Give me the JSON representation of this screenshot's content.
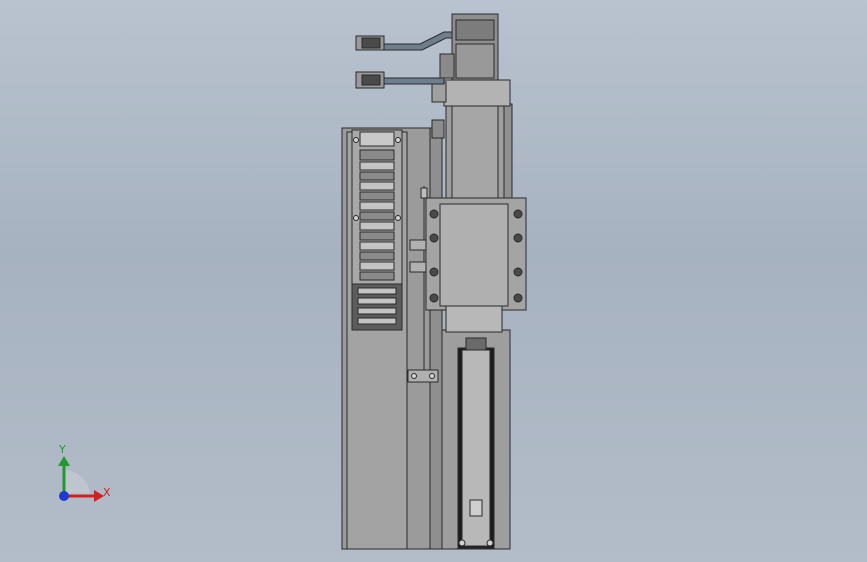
{
  "viewport": {
    "background_top": "#b9c3cf",
    "background_bottom": "#a7b2c1"
  },
  "model": {
    "part_fill": "#9b9b9b",
    "part_stroke": "#2a2a2a",
    "motor_fill": "#8e8e8e",
    "cable_fill": "#6d7f8f",
    "slot_fill": "#1c1c1c",
    "highlight_fill": "#b8b8b8"
  },
  "triad": {
    "x_label": "X",
    "y_label": "Y",
    "x_color": "#d21f1f",
    "y_color": "#1f9a2c",
    "z_color": "#1f3ad2"
  }
}
